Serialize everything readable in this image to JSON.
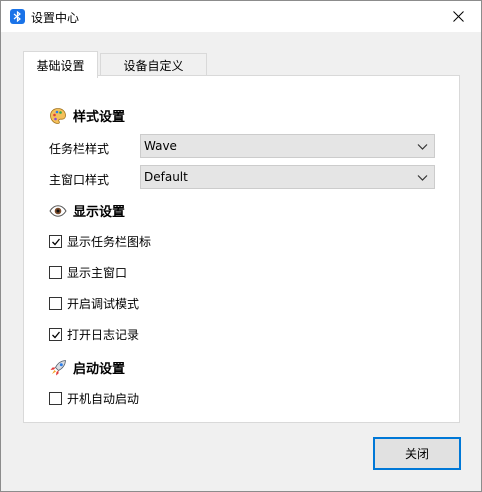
{
  "window": {
    "title": "设置中心"
  },
  "tabs": [
    {
      "label": "基础设置",
      "active": true
    },
    {
      "label": "设备自定义",
      "active": false
    }
  ],
  "sections": {
    "style": {
      "title": "样式设置",
      "icon": "palette-icon",
      "taskbar_label": "任务栏样式",
      "taskbar_value": "Wave",
      "mainwindow_label": "主窗口样式",
      "mainwindow_value": "Default"
    },
    "display": {
      "title": "显示设置",
      "icon": "eye-icon",
      "options": [
        {
          "label": "显示任务栏图标",
          "checked": true
        },
        {
          "label": "显示主窗口",
          "checked": false
        },
        {
          "label": "开启调试模式",
          "checked": false
        },
        {
          "label": "打开日志记录",
          "checked": true
        }
      ]
    },
    "startup": {
      "title": "启动设置",
      "icon": "rocket-icon",
      "options": [
        {
          "label": "开机自动启动",
          "checked": false
        }
      ]
    }
  },
  "buttons": {
    "close_label": "关闭"
  },
  "colors": {
    "accent": "#0078d7",
    "app_icon": "#1a73e8"
  }
}
